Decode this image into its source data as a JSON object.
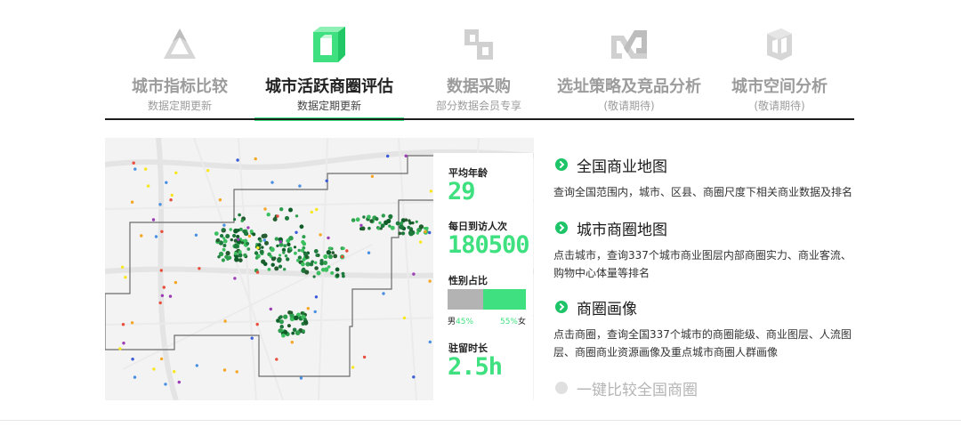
{
  "tabs": [
    {
      "title": "城市指标比较",
      "subtitle": "数据定期更新",
      "icon": "triangle-icon",
      "active": false
    },
    {
      "title": "城市活跃商圈评估",
      "subtitle": "数据定期更新",
      "icon": "cube-frame-icon",
      "active": true
    },
    {
      "title": "数据采购",
      "subtitle": "部分数据会员专享",
      "icon": "blocks-icon",
      "active": false
    },
    {
      "title": "选址策略及竞品分析",
      "subtitle": "(敬请期待)",
      "icon": "infinity-icon",
      "active": false
    },
    {
      "title": "城市空间分析",
      "subtitle": "(敬请期待)",
      "icon": "prism-icon",
      "active": false
    }
  ],
  "stats": {
    "avg_age_label": "平均年龄",
    "avg_age_value": "29",
    "daily_visits_label": "每日到访人次",
    "daily_visits_value": "180500",
    "gender_label": "性别占比",
    "male_label": "男",
    "male_pct": "45%",
    "female_label": "女",
    "female_pct": "55%",
    "male_fraction": 0.45,
    "dwell_label": "驻留时长",
    "dwell_value": "2.5h"
  },
  "features": [
    {
      "title": "全国商业地图",
      "desc": "查询全国范围内，城市、区县、商圈尺度下相关商业数据及排名",
      "active": true
    },
    {
      "title": "城市商圈地图",
      "desc": "点击城市，查询337个城市商业图层内部商圈实力、商业客流、购物中心体量等排名",
      "active": true
    },
    {
      "title": "商圈画像",
      "desc": "点击商圈，查询全国337个城市的商圈能级、商业图层、人流图层、商圈商业资源画像及重点城市商圈人群画像",
      "active": true
    },
    {
      "title": "一键比较全国商圈",
      "desc": "",
      "active": false
    }
  ],
  "colors": {
    "accent": "#3ee07f",
    "bullet": "#1dc468",
    "inactive": "#9c9c9c"
  }
}
